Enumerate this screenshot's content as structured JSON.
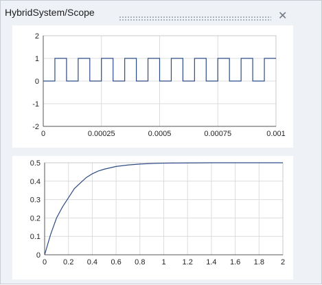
{
  "window": {
    "title": "HybridSystem/Scope",
    "close_icon": "close-icon",
    "grip_icon": "drag-grip-icon"
  },
  "colors": {
    "trace": "#2c4a86",
    "grid": "#dcdcdc",
    "axis": "#555555",
    "panel": "#eef1f6"
  },
  "chart_data": [
    {
      "type": "line",
      "title": "",
      "xlabel": "",
      "ylabel": "",
      "xlim": [
        0,
        0.001
      ],
      "ylim": [
        -2,
        2
      ],
      "grid": true,
      "xticks": [
        "0",
        "0.00025",
        "0.0005",
        "0.00075",
        "0.001"
      ],
      "yticks": [
        "2",
        "1",
        "0",
        "-1",
        "-2"
      ],
      "series": [
        {
          "x": [
            0,
            5e-05,
            5e-05,
            0.0001,
            0.0001,
            0.00015,
            0.00015,
            0.0002,
            0.0002,
            0.00025,
            0.00025,
            0.0003,
            0.0003,
            0.00035,
            0.00035,
            0.0004,
            0.0004,
            0.00045,
            0.00045,
            0.0005,
            0.0005,
            0.00055,
            0.00055,
            0.0006,
            0.0006,
            0.00065,
            0.00065,
            0.0007,
            0.0007,
            0.00075,
            0.00075,
            0.0008,
            0.0008,
            0.00085,
            0.00085,
            0.0009,
            0.0009,
            0.00095,
            0.00095,
            0.001
          ],
          "y": [
            0,
            0,
            1,
            1,
            0,
            0,
            1,
            1,
            0,
            0,
            1,
            1,
            0,
            0,
            1,
            1,
            0,
            0,
            1,
            1,
            0,
            0,
            1,
            1,
            0,
            0,
            1,
            1,
            0,
            0,
            1,
            1,
            0,
            0,
            1,
            1,
            0,
            0,
            1,
            1
          ]
        }
      ]
    },
    {
      "type": "line",
      "title": "",
      "xlabel": "",
      "ylabel": "",
      "xlim": [
        0,
        2
      ],
      "ylim": [
        0,
        0.5
      ],
      "grid": true,
      "xticks": [
        "0",
        "0.2",
        "0.4",
        "0.6",
        "0.8",
        "1",
        "1.2",
        "1.4",
        "1.6",
        "1.8",
        "2"
      ],
      "yticks": [
        "0.5",
        "0.4",
        "0.3",
        "0.2",
        "0.1",
        "0"
      ],
      "series": [
        {
          "x": [
            0,
            0.05,
            0.1,
            0.15,
            0.2,
            0.25,
            0.3,
            0.35,
            0.4,
            0.45,
            0.5,
            0.6,
            0.7,
            0.8,
            0.9,
            1.0,
            1.2,
            1.4,
            1.6,
            1.8,
            2.0
          ],
          "y": [
            0,
            0.11,
            0.2,
            0.26,
            0.31,
            0.36,
            0.39,
            0.42,
            0.44,
            0.455,
            0.465,
            0.48,
            0.488,
            0.493,
            0.496,
            0.498,
            0.499,
            0.5,
            0.5,
            0.5,
            0.5
          ]
        }
      ]
    }
  ]
}
